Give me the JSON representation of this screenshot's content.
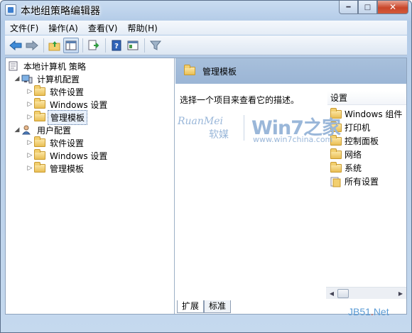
{
  "window": {
    "title": "本地组策略编辑器",
    "min_glyph": "━",
    "max_glyph": "□",
    "close_glyph": "✕"
  },
  "menu": [
    "文件(F)",
    "操作(A)",
    "查看(V)",
    "帮助(H)"
  ],
  "toolbar": {
    "buttons": [
      "back-icon",
      "forward-icon",
      "up-folder-icon",
      "show-hide-tree-icon",
      "export-list-icon",
      "help-icon",
      "properties-icon",
      "filter-icon"
    ]
  },
  "tree": {
    "root": "本地计算机 策略",
    "computer": {
      "label": "计算机配置",
      "children": [
        "软件设置",
        "Windows 设置",
        "管理模板"
      ]
    },
    "user": {
      "label": "用户配置",
      "children": [
        "软件设置",
        "Windows 设置",
        "管理模板"
      ]
    },
    "selected": "管理模板"
  },
  "right_pane": {
    "header_title": "管理模板",
    "description": "选择一个项目来查看它的描述。",
    "column_header": "设置",
    "items": [
      "Windows 组件",
      "打印机",
      "控制面板",
      "网络",
      "系统",
      "所有设置"
    ]
  },
  "tabs": [
    "扩展",
    "标准"
  ],
  "watermarks": {
    "ruanmei_en": "RuanMei",
    "ruanmei_cn": "软媒",
    "win7": "Win7之家",
    "win7_url": "www.win7china.com",
    "jb51": "JB51",
    "jb51_dot": ".",
    "jb51_net": "Net"
  },
  "colors": {
    "title_gradient_top": "#c9dcf1",
    "pane_header": "#a8c0dc",
    "close_button": "#c9462a",
    "folder": "#e9bf55",
    "watermark": "#9ab7d9"
  }
}
